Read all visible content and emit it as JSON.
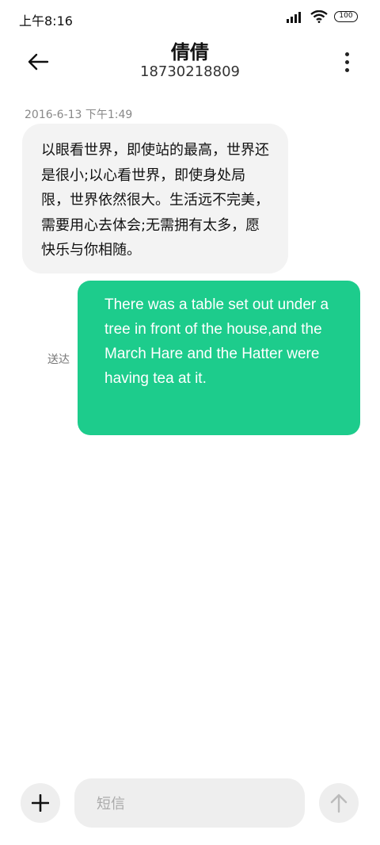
{
  "status_bar": {
    "time": "上午8:16",
    "battery": "100",
    "icons": [
      "signal-icon",
      "wifi-icon",
      "battery-icon"
    ]
  },
  "header": {
    "contact_name": "倩倩",
    "phone_number": "18730218809",
    "icons": [
      "back-arrow-icon",
      "more-vertical-icon"
    ]
  },
  "messages": [
    {
      "direction": "incoming",
      "timestamp": "2016-6-13 下午1:49",
      "text": "以眼看世界，即使站的最高，世界还是很小;以心看世界，即使身处局限，世界依然很大。生活远不完美，需要用心去体会;无需拥有太多，愿快乐与你相随。"
    },
    {
      "direction": "outgoing",
      "status": "送达",
      "text": "There was a table set out under a tree in front of the house,and the March Hare and the Hatter were having tea at it."
    }
  ],
  "composer": {
    "placeholder": "短信",
    "icons": [
      "plus-icon",
      "send-arrow-icon"
    ]
  },
  "colors": {
    "outgoing_bubble": "#1dcc8c",
    "incoming_bubble": "#f3f3f3",
    "composer_bg": "#eeeeee"
  }
}
